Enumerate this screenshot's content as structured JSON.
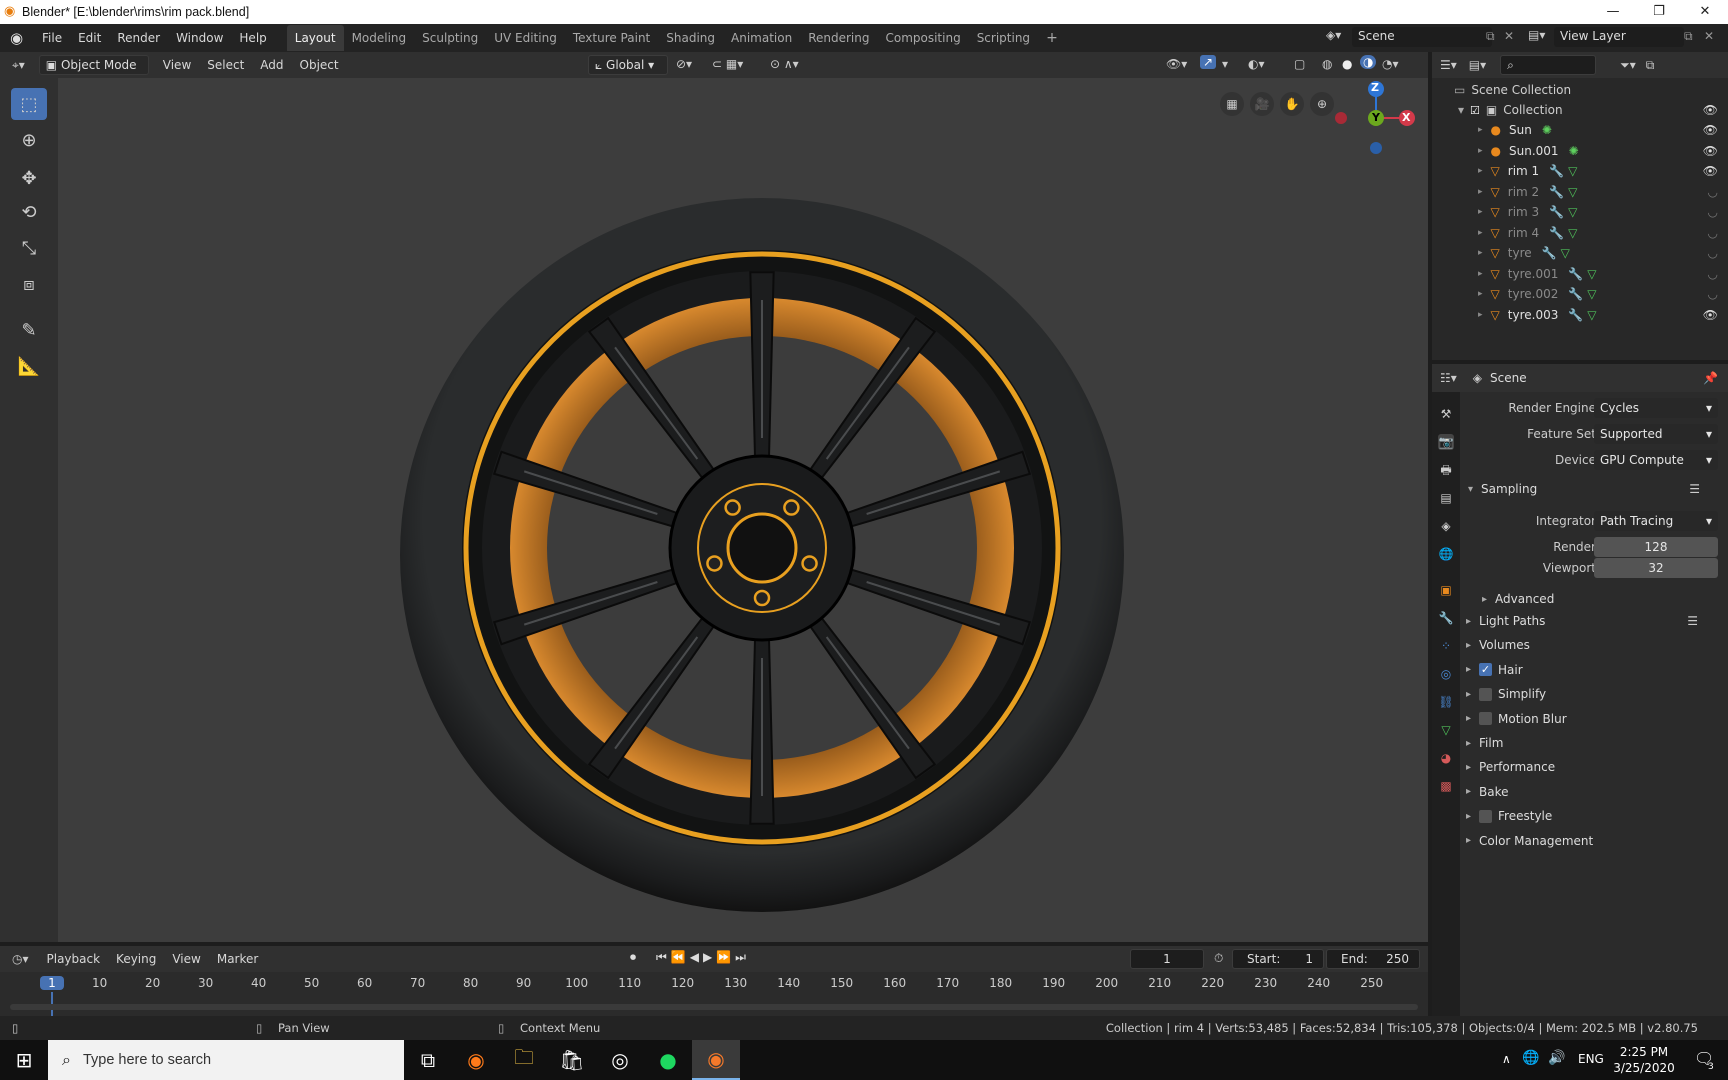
{
  "window": {
    "title": "Blender* [E:\\blender\\rims\\rim pack.blend]"
  },
  "menu": [
    "File",
    "Edit",
    "Render",
    "Window",
    "Help"
  ],
  "workspaces": [
    {
      "label": "Layout",
      "active": true
    },
    {
      "label": "Modeling"
    },
    {
      "label": "Sculpting"
    },
    {
      "label": "UV Editing"
    },
    {
      "label": "Texture Paint"
    },
    {
      "label": "Shading"
    },
    {
      "label": "Animation"
    },
    {
      "label": "Rendering"
    },
    {
      "label": "Compositing"
    },
    {
      "label": "Scripting"
    }
  ],
  "scene": {
    "name": "Scene"
  },
  "view_layer": {
    "name": "View Layer"
  },
  "viewport_header": {
    "mode": "Object Mode",
    "menus": [
      "View",
      "Select",
      "Add",
      "Object"
    ],
    "orientation": "Global"
  },
  "gizmo": {
    "z": "Z",
    "y": "Y",
    "x": "X"
  },
  "outliner": {
    "root": "Scene Collection",
    "collection": "Collection",
    "items": [
      {
        "name": "Sun",
        "type": "light",
        "visible": true
      },
      {
        "name": "Sun.001",
        "type": "light",
        "visible": true
      },
      {
        "name": "rim 1",
        "type": "mesh",
        "visible": true
      },
      {
        "name": "rim 2",
        "type": "mesh",
        "visible": false
      },
      {
        "name": "rim 3",
        "type": "mesh",
        "visible": false
      },
      {
        "name": "rim 4",
        "type": "mesh",
        "visible": false
      },
      {
        "name": "tyre",
        "type": "mesh",
        "visible": false
      },
      {
        "name": "tyre.001",
        "type": "mesh",
        "visible": false
      },
      {
        "name": "tyre.002",
        "type": "mesh",
        "visible": false
      },
      {
        "name": "tyre.003",
        "type": "mesh",
        "visible": true
      }
    ]
  },
  "properties": {
    "context": "Scene",
    "render_engine": {
      "label": "Render Engine",
      "value": "Cycles"
    },
    "feature_set": {
      "label": "Feature Set",
      "value": "Supported"
    },
    "device": {
      "label": "Device",
      "value": "GPU Compute"
    },
    "sampling": {
      "title": "Sampling",
      "integrator_label": "Integrator",
      "integrator": "Path Tracing",
      "render_label": "Render",
      "render": "128",
      "viewport_label": "Viewport",
      "viewport": "32",
      "advanced": "Advanced"
    },
    "sections": [
      {
        "label": "Light Paths"
      },
      {
        "label": "Volumes"
      },
      {
        "label": "Hair",
        "checkbox": true,
        "checked": true
      },
      {
        "label": "Simplify",
        "checkbox": true,
        "checked": false
      },
      {
        "label": "Motion Blur",
        "checkbox": true,
        "checked": false
      },
      {
        "label": "Film"
      },
      {
        "label": "Performance"
      },
      {
        "label": "Bake"
      },
      {
        "label": "Freestyle",
        "checkbox": true,
        "checked": false
      },
      {
        "label": "Color Management"
      }
    ]
  },
  "timeline": {
    "menus": [
      "Playback",
      "Keying",
      "View",
      "Marker"
    ],
    "current_frame": "1",
    "start_label": "Start:",
    "start": "1",
    "end_label": "End:",
    "end": "250",
    "ticks": [
      "1",
      "10",
      "20",
      "30",
      "40",
      "50",
      "60",
      "70",
      "80",
      "90",
      "100",
      "110",
      "120",
      "130",
      "140",
      "150",
      "160",
      "170",
      "180",
      "190",
      "200",
      "210",
      "220",
      "230",
      "240",
      "250"
    ]
  },
  "status": {
    "pan": "Pan View",
    "context": "Context Menu",
    "stats": "Collection | rim 4 | Verts:53,485 | Faces:52,834 | Tris:105,378 | Objects:0/4 | Mem: 202.5 MB | v2.80.75"
  },
  "taskbar": {
    "search_placeholder": "Type here to search",
    "lang": "ENG",
    "time": "2:25 PM",
    "date": "3/25/2020",
    "notif": "3"
  },
  "colors": {
    "accent": "#4772b3",
    "rim_orange": "#e8a020",
    "viewport_bg": "#3d3d3d"
  }
}
